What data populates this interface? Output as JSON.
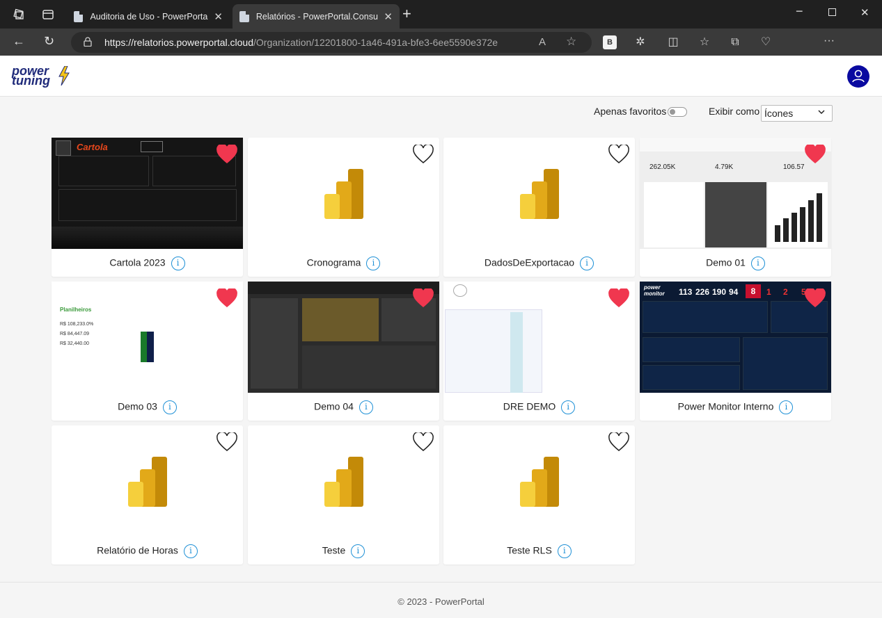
{
  "browser": {
    "tabs": [
      {
        "title": "Auditoria de Uso - PowerPortal.M",
        "active": false
      },
      {
        "title": "Relatórios - PowerPortal.Consum",
        "active": true
      }
    ],
    "url_host": "https://relatorios.powerportal.cloud",
    "url_path": "/Organization/12201800-1a46-491a-bfe3-6ee5590e372e",
    "ext_b_label": "B"
  },
  "header": {
    "logo_line1": "power",
    "logo_line2": "tuning"
  },
  "filters": {
    "favorites_label": "Apenas favoritos",
    "favorites_on": false,
    "view_label": "Exibir como",
    "view_value": "Ícones"
  },
  "reports": [
    {
      "name": "Cartola 2023",
      "favorite": true,
      "thumb": "cartola"
    },
    {
      "name": "Cronograma",
      "favorite": false,
      "thumb": "pbi"
    },
    {
      "name": "DadosDeExportacao",
      "favorite": false,
      "thumb": "pbi"
    },
    {
      "name": "Demo 01",
      "favorite": true,
      "thumb": "demo01"
    },
    {
      "name": "Demo 03",
      "favorite": true,
      "thumb": "demo03"
    },
    {
      "name": "Demo 04",
      "favorite": true,
      "thumb": "demo04"
    },
    {
      "name": "DRE DEMO",
      "favorite": true,
      "thumb": "dre"
    },
    {
      "name": "Power Monitor Interno",
      "favorite": true,
      "thumb": "monitor"
    },
    {
      "name": "Relatório de Horas",
      "favorite": false,
      "thumb": "pbi"
    },
    {
      "name": "Teste",
      "favorite": false,
      "thumb": "pbi"
    },
    {
      "name": "Teste RLS",
      "favorite": false,
      "thumb": "pbi"
    }
  ],
  "thumb_text": {
    "cartola_logo": "Cartola",
    "demo01_kpis": [
      "262.05K",
      "4.79K",
      "106.57"
    ],
    "demo03_values": [
      "R$ 108,233.0%",
      "R$ 84,447.09",
      "R$ 32,440.00"
    ],
    "monitor_kpis": [
      "113",
      "226",
      "190",
      "94",
      "8",
      "1",
      "2",
      "5"
    ],
    "monitor_logo": "power monitor"
  },
  "footer": "© 2023 - PowerPortal",
  "colors": {
    "heart_fav": "#f0374f",
    "info_blue": "#1e90d6",
    "user_btn": "#0a0aa0",
    "pbi_gold": "#e8b71a"
  }
}
